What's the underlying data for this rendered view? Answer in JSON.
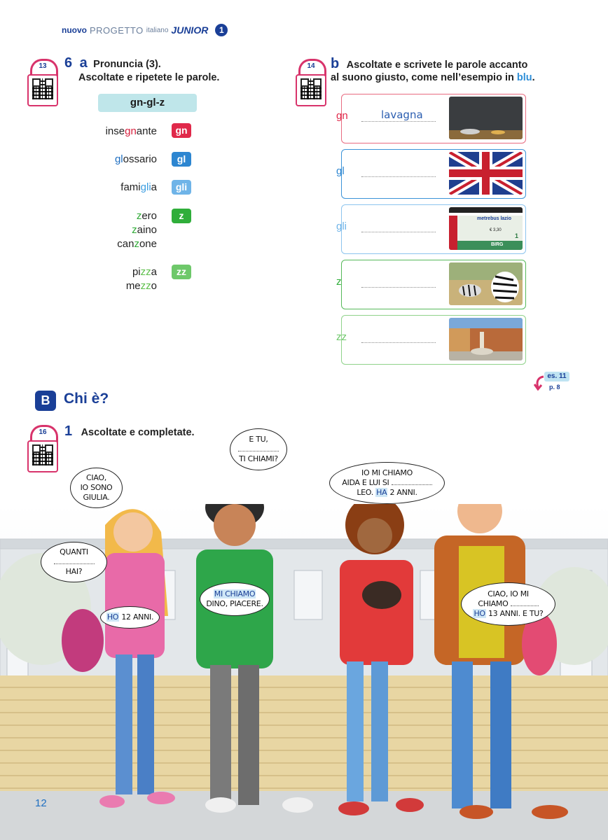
{
  "header": {
    "nuovo": "nuovo",
    "progetto": "PROGETTO",
    "italiano": "italiano",
    "junior": "JUNIOR",
    "volume": "1"
  },
  "ex6a": {
    "track": "13",
    "number": "6",
    "letter": "a",
    "title": "Pronuncia (3).",
    "instruction": "Ascoltate e ripetete le parole.",
    "pill": "gn-gl-z",
    "rows": [
      {
        "parts": [
          "inse",
          "gn",
          "ante"
        ],
        "tag": "gn",
        "tag_color": "#e0294a"
      },
      {
        "parts": [
          "",
          "gl",
          "ossario"
        ],
        "tag": "gl",
        "tag_color": "#2d86d1"
      },
      {
        "parts": [
          "fami",
          "gli",
          "a"
        ],
        "tag": "gli",
        "tag_color": "#6fb4e8"
      },
      {
        "parts": [
          "",
          "z",
          "ero"
        ],
        "tag": "z",
        "tag_color": "#2fae3a"
      },
      {
        "parts": [
          "",
          "z",
          "aino"
        ]
      },
      {
        "parts": [
          "can",
          "z",
          "one"
        ]
      },
      {
        "parts": [
          "pi",
          "zz",
          "a"
        ],
        "tag": "zz",
        "tag_color": "#6ec86a"
      },
      {
        "parts": [
          "me",
          "zz",
          "o"
        ]
      }
    ]
  },
  "ex6b": {
    "track": "14",
    "letter": "b",
    "instruction_1": "Ascoltate e scrivete le parole accanto",
    "instruction_2": "al suono giusto, come nell’esempio in",
    "instruction_blu": "blu",
    "instruction_end": ".",
    "boxes": [
      {
        "label": "gn",
        "answer": "lavagna",
        "color": "#e0294a",
        "border": "#e86b80",
        "image": "blackboard"
      },
      {
        "label": "gl",
        "answer": "",
        "color": "#2d86d1",
        "border": "#3b93d8",
        "image": "union-jack"
      },
      {
        "label": "gli",
        "answer": "",
        "color": "#6fb4e8",
        "border": "#8cc4ee",
        "image": "metro-ticket"
      },
      {
        "label": "z",
        "answer": "",
        "color": "#2fae3a",
        "border": "#56b95a",
        "image": "zebra"
      },
      {
        "label": "zz",
        "answer": "",
        "color": "#6ec86a",
        "border": "#8fd28a",
        "image": "piazza"
      }
    ],
    "ticket_text_1": "metrebus lazio",
    "ticket_text_2": "BIRG",
    "ticket_text_3": "€ 3,30",
    "ticket_text_4": "1"
  },
  "ref": {
    "label": "es. 11",
    "page": "p. 8"
  },
  "sectionB": {
    "letter": "B",
    "title": "Chi è?"
  },
  "ex1": {
    "track": "16",
    "number": "1",
    "instruction": "Ascoltate e completate."
  },
  "bubbles": {
    "giulia": {
      "l1": "CIAO,",
      "l2": "IO SONO",
      "l3": "GIULIA."
    },
    "quanti": {
      "l1": "QUANTI",
      "l3": "HAI?"
    },
    "ho12": {
      "mark": "HO",
      "rest": "12 ANNI."
    },
    "etu": {
      "l1": "E TU,",
      "l3": "TI CHIAMI?"
    },
    "mi_chiamo": {
      "mark": "MI CHIAMO",
      "l2": "DINO, PIACERE."
    },
    "aida": {
      "l1": "IO MI CHIAMO",
      "l2": "AIDA E LUI SI",
      "l3a": "LEO.",
      "mark": "HA",
      "l3b": "2 ANNI."
    },
    "leo": {
      "l1": "CIAO, IO MI",
      "l2": "CHIAMO",
      "mark": "HO",
      "l3": "13 ANNI. E TU?"
    }
  },
  "page_number": "12"
}
